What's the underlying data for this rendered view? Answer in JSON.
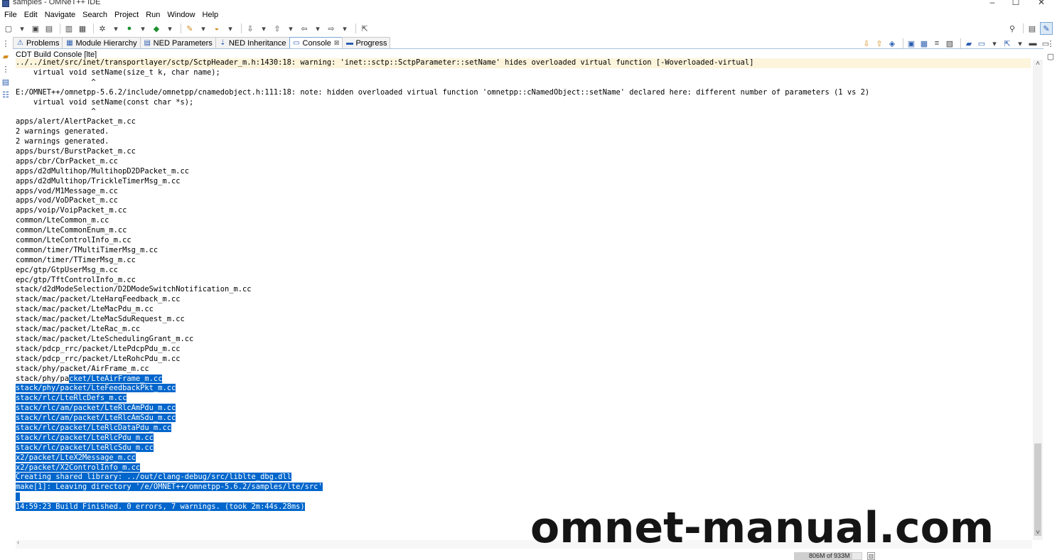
{
  "window": {
    "title": "samples - OMNeT++ IDE",
    "minimize": "–",
    "maximize": "☐",
    "close": "✕"
  },
  "menubar": [
    "File",
    "Edit",
    "Navigate",
    "Search",
    "Project",
    "Run",
    "Window",
    "Help"
  ],
  "tabs": [
    {
      "label": "Problems",
      "icon": "problems-icon",
      "active": false,
      "close": ""
    },
    {
      "label": "Module Hierarchy",
      "icon": "module-hierarchy-icon",
      "active": false,
      "close": ""
    },
    {
      "label": "NED Parameters",
      "icon": "ned-parameters-icon",
      "active": false,
      "close": ""
    },
    {
      "label": "NED Inheritance",
      "icon": "ned-inheritance-icon",
      "active": false,
      "close": ""
    },
    {
      "label": "Console",
      "icon": "console-icon",
      "active": true,
      "close": "⊠"
    },
    {
      "label": "Progress",
      "icon": "progress-icon",
      "active": false,
      "close": ""
    }
  ],
  "console": {
    "title": "CDT Build Console [lte]",
    "lines": [
      {
        "text": "../../inet/src/inet/transportlayer/sctp/SctpHeader_m.h:1430:18: warning: 'inet::sctp::SctpParameter::setName' hides overloaded virtual function [-Woverloaded-virtual]",
        "highlight": true
      },
      {
        "text": "    virtual void setName(size_t k, char name);"
      },
      {
        "text": "                 ^"
      },
      {
        "text": "E:/OMNET++/omnetpp-5.6.2/include/omnetpp/cnamedobject.h:111:18: note: hidden overloaded virtual function 'omnetpp::cNamedObject::setName' declared here: different number of parameters (1 vs 2)"
      },
      {
        "text": "    virtual void setName(const char *s);"
      },
      {
        "text": "                 ^"
      },
      {
        "text": "apps/alert/AlertPacket_m.cc"
      },
      {
        "text": "2 warnings generated."
      },
      {
        "text": "2 warnings generated."
      },
      {
        "text": "apps/burst/BurstPacket_m.cc"
      },
      {
        "text": "apps/cbr/CbrPacket_m.cc"
      },
      {
        "text": "apps/d2dMultihop/MultihopD2DPacket_m.cc"
      },
      {
        "text": "apps/d2dMultihop/TrickleTimerMsg_m.cc"
      },
      {
        "text": "apps/vod/M1Message_m.cc"
      },
      {
        "text": "apps/vod/VoDPacket_m.cc"
      },
      {
        "text": "apps/voip/VoipPacket_m.cc"
      },
      {
        "text": "common/LteCommon_m.cc"
      },
      {
        "text": "common/LteCommonEnum_m.cc"
      },
      {
        "text": "common/LteControlInfo_m.cc"
      },
      {
        "text": "common/timer/TMultiTimerMsg_m.cc"
      },
      {
        "text": "common/timer/TTimerMsg_m.cc"
      },
      {
        "text": "epc/gtp/GtpUserMsg_m.cc"
      },
      {
        "text": "epc/gtp/TftControlInfo_m.cc"
      },
      {
        "text": "stack/d2dModeSelection/D2DModeSwitchNotification_m.cc"
      },
      {
        "text": "stack/mac/packet/LteHarqFeedback_m.cc"
      },
      {
        "text": "stack/mac/packet/LteMacPdu_m.cc"
      },
      {
        "text": "stack/mac/packet/LteMacSduRequest_m.cc"
      },
      {
        "text": "stack/mac/packet/LteRac_m.cc"
      },
      {
        "text": "stack/mac/packet/LteSchedulingGrant_m.cc"
      },
      {
        "text": "stack/pdcp_rrc/packet/LtePdcpPdu_m.cc"
      },
      {
        "text": "stack/pdcp_rrc/packet/LteRohcPdu_m.cc"
      },
      {
        "text": "stack/phy/packet/AirFrame_m.cc"
      },
      {
        "text": "stack/phy/pa",
        "sel": "cket/LteAirFrame_m.cc"
      },
      {
        "text": "",
        "sel": "stack/phy/packet/LteFeedbackPkt_m.cc"
      },
      {
        "text": "",
        "sel": "stack/rlc/LteRlcDefs_m.cc"
      },
      {
        "text": "",
        "sel": "stack/rlc/am/packet/LteRlcAmPdu_m.cc"
      },
      {
        "text": "",
        "sel": "stack/rlc/am/packet/LteRlcAmSdu_m.cc"
      },
      {
        "text": "",
        "sel": "stack/rlc/packet/LteRlcDataPdu_m.cc"
      },
      {
        "text": "",
        "sel": "stack/rlc/packet/LteRlcPdu_m.cc"
      },
      {
        "text": "",
        "sel": "stack/rlc/packet/LteRlcSdu_m.cc"
      },
      {
        "text": "",
        "sel": "x2/packet/LteX2Message_m.cc"
      },
      {
        "text": "",
        "sel": "x2/packet/X2ControlInfo_m.cc"
      },
      {
        "text": "",
        "sel": "Creating shared library: ../out/clang-debug/src/liblte_dbg.dll"
      },
      {
        "text": "",
        "sel": "make[1]: Leaving directory '/e/OMNET++/omnetpp-5.6.2/samples/lte/src'"
      },
      {
        "text": "",
        "sel": " "
      },
      {
        "text": "",
        "sel": "14:59:23 Build Finished. 0 errors, 7 warnings. (took 2m:44s.28ms)"
      }
    ]
  },
  "statusbar": {
    "heap": "806M of 933M",
    "heap_used_fraction": 0.864
  },
  "watermark": "omnet-manual.com",
  "colors": {
    "selection": "#0066cc",
    "warning_line": "#fdf4dc",
    "active_tab_border": "#7aa7d8"
  }
}
